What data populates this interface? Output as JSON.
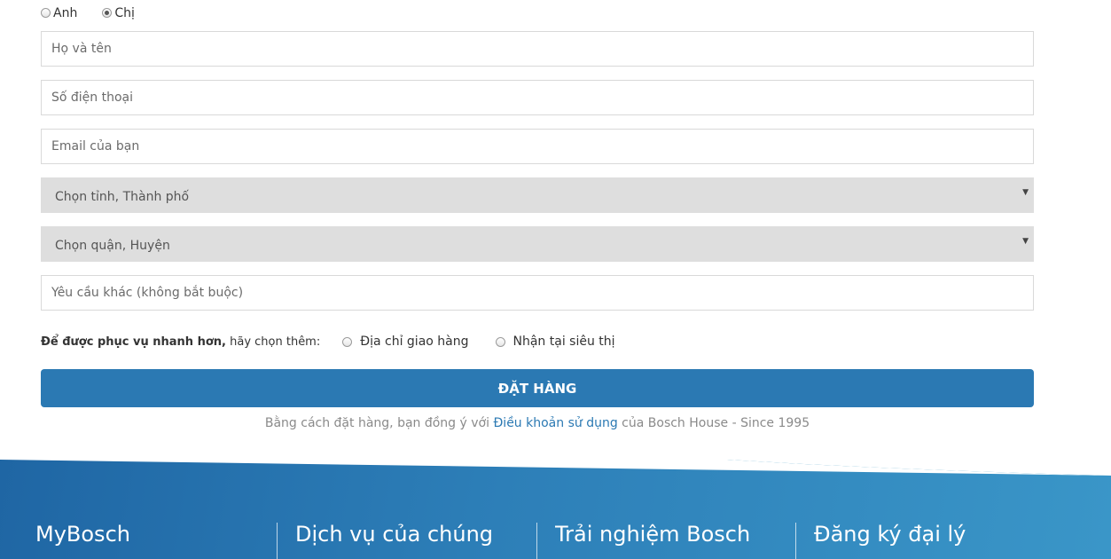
{
  "gender": {
    "options": [
      "Anh",
      "Chị"
    ],
    "selected": "Chị"
  },
  "form": {
    "name_placeholder": "Họ và tên",
    "phone_placeholder": "Số điện thoại",
    "email_placeholder": "Email của bạn",
    "city_select": "Chọn tỉnh, Thành phố",
    "district_select": "Chọn quận, Huyện",
    "note_placeholder": "Yêu cầu khác (không bắt buộc)"
  },
  "delivery": {
    "lead_bold": "Để được phục vụ nhanh hơn,",
    "lead_rest": "hãy chọn thêm:",
    "options": [
      "Địa chỉ giao hàng",
      "Nhận tại siêu thị"
    ]
  },
  "order_button": "ĐẶT HÀNG",
  "terms": {
    "prefix": "Bằng cách đặt hàng, bạn đồng ý với",
    "link": "Điều khoản sử dụng",
    "suffix": "của Bosch House - Since 1995"
  },
  "footer": {
    "columns": [
      "MyBosch",
      "Dịch vụ của chúng",
      "Trải nghiệm Bosch",
      "Đăng ký đại lý"
    ]
  },
  "colors": {
    "primary": "#2b79b3",
    "select_bg": "#dedede",
    "footer_start": "#1f66a4",
    "footer_end": "#3a96c8"
  }
}
